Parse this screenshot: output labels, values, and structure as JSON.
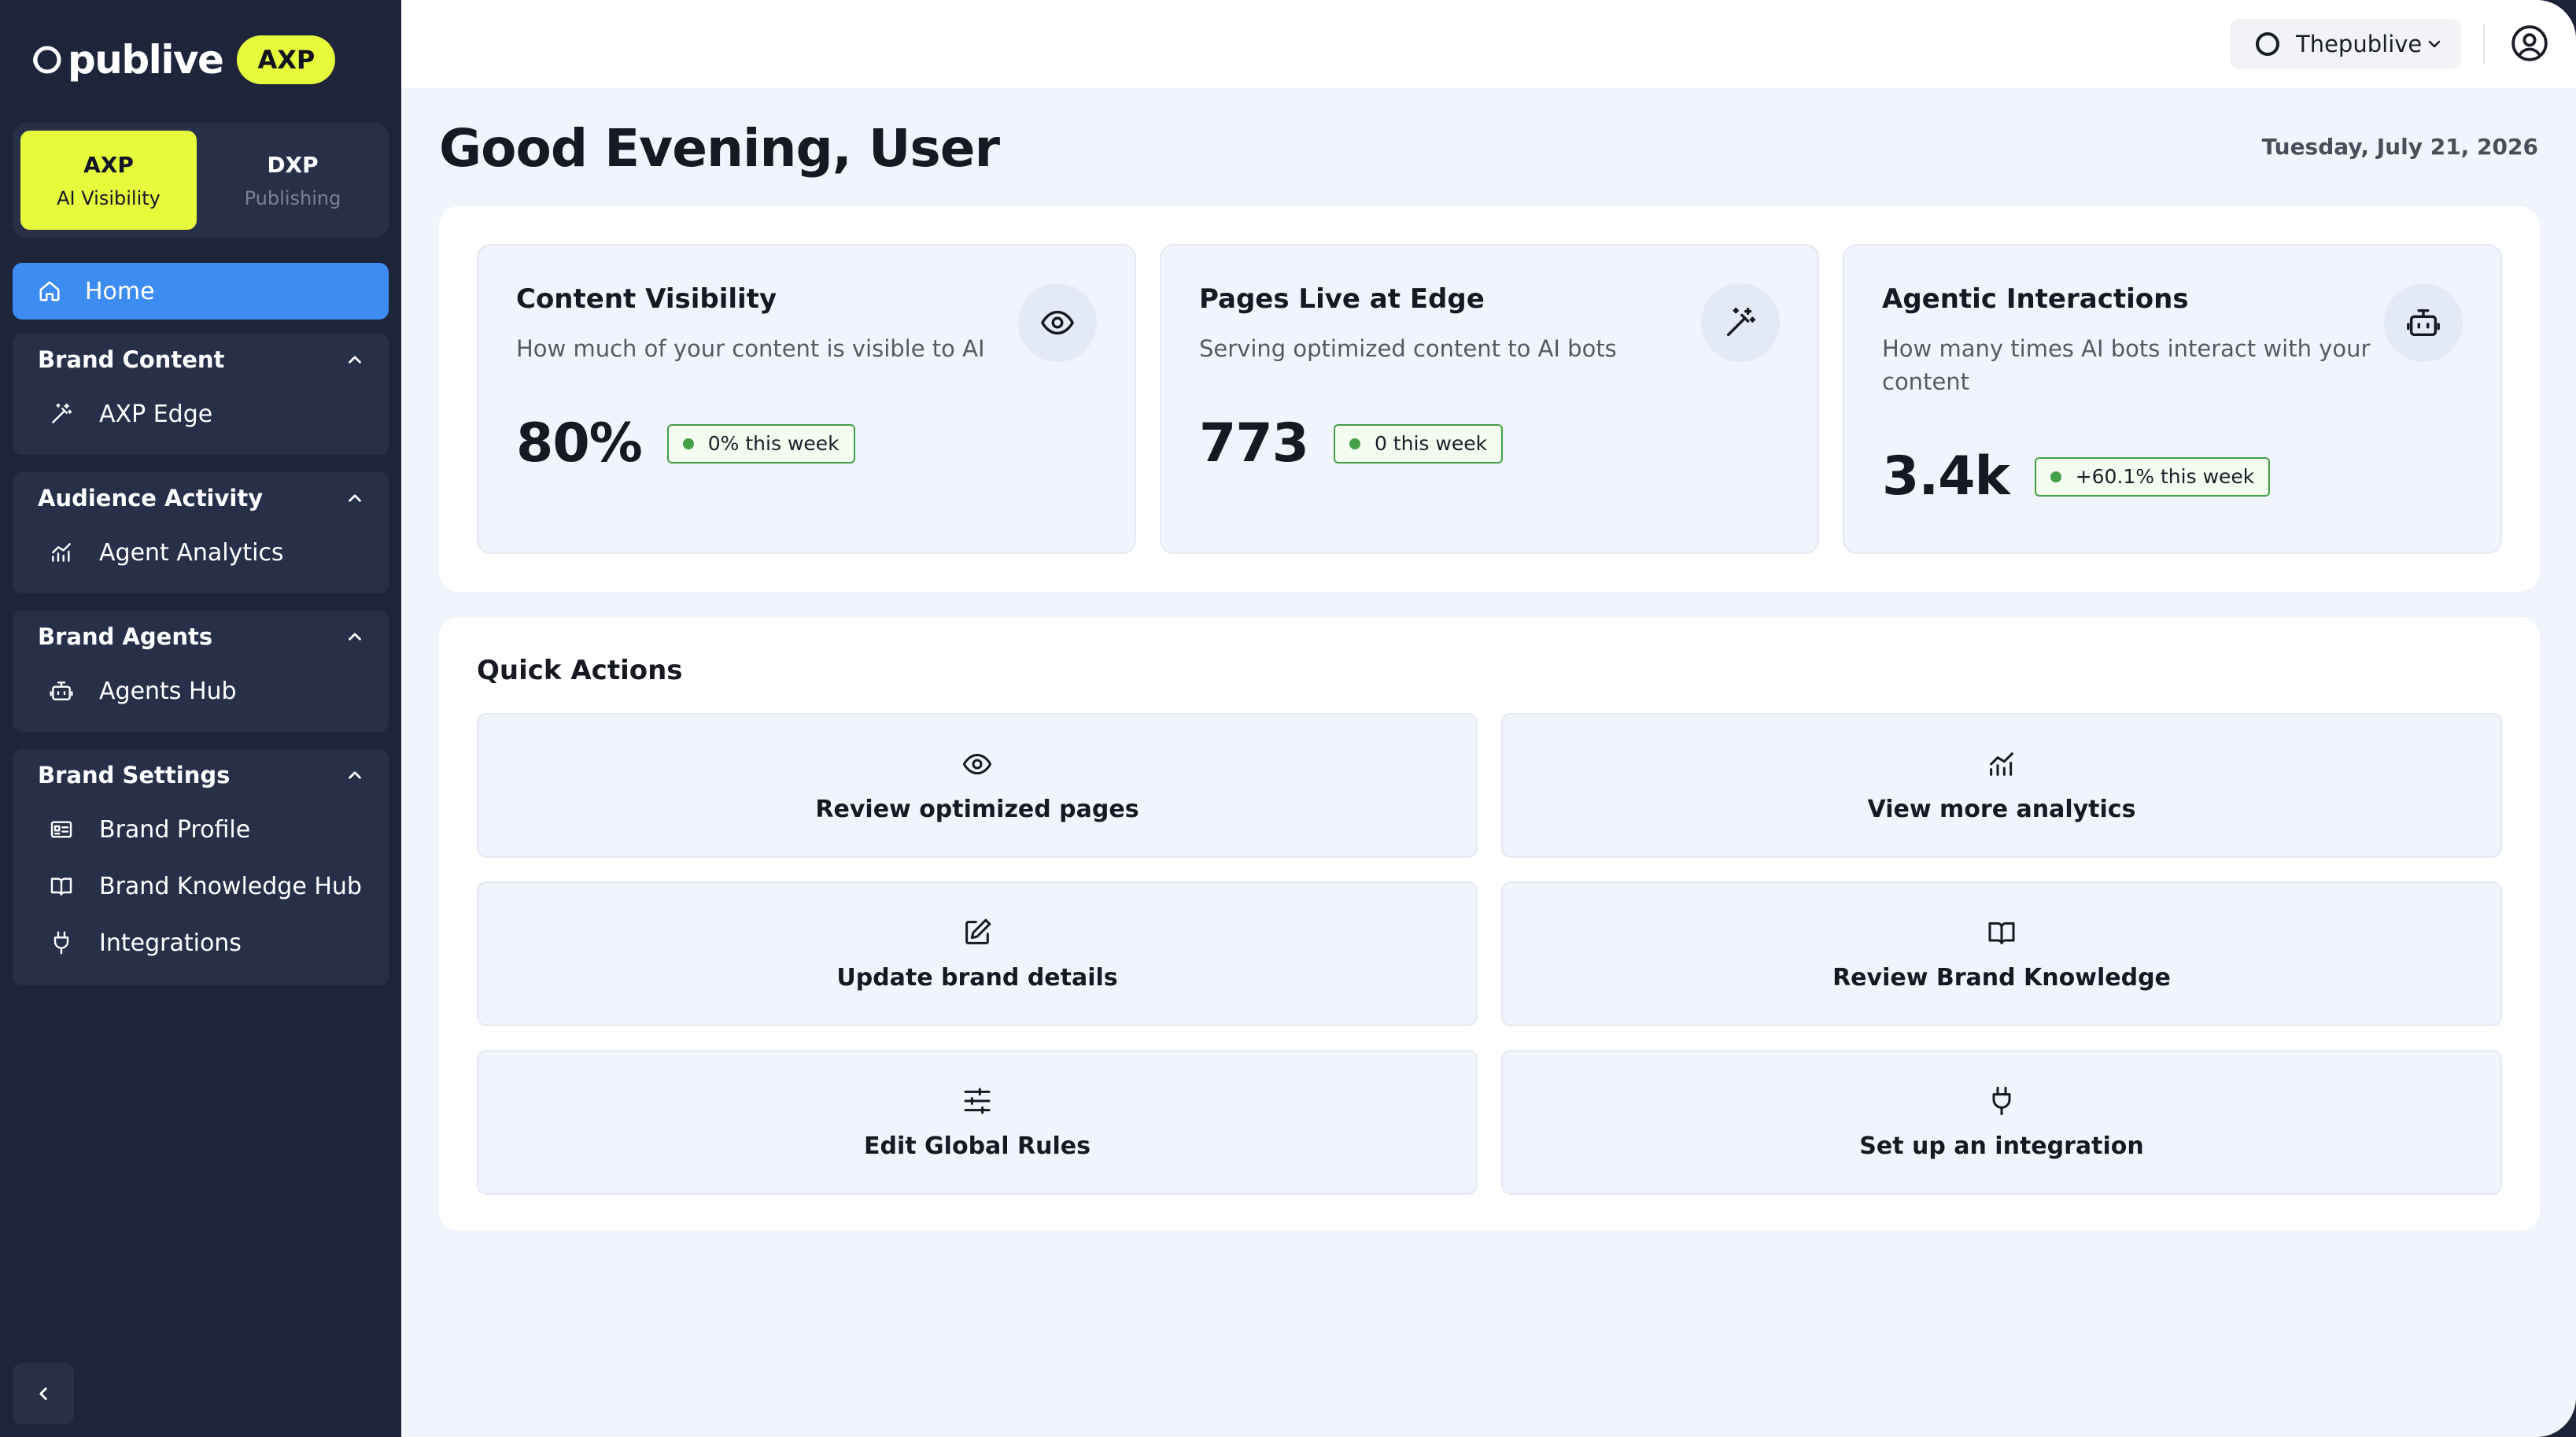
{
  "brand": {
    "name": "publive",
    "badge": "AXP"
  },
  "modes": [
    {
      "title": "AXP",
      "subtitle": "AI Visibility",
      "active": true
    },
    {
      "title": "DXP",
      "subtitle": "Publishing",
      "active": false
    }
  ],
  "nav": {
    "home": "Home",
    "groups": [
      {
        "label": "Brand Content",
        "items": [
          {
            "label": "AXP Edge",
            "icon": "wand-icon"
          }
        ]
      },
      {
        "label": "Audience Activity",
        "items": [
          {
            "label": "Agent Analytics",
            "icon": "analytics-icon"
          }
        ]
      },
      {
        "label": "Brand Agents",
        "items": [
          {
            "label": "Agents Hub",
            "icon": "bot-icon"
          }
        ]
      },
      {
        "label": "Brand Settings",
        "items": [
          {
            "label": "Brand Profile",
            "icon": "id-card-icon"
          },
          {
            "label": "Brand Knowledge Hub",
            "icon": "book-icon"
          },
          {
            "label": "Integrations",
            "icon": "plug-icon"
          }
        ]
      }
    ]
  },
  "header": {
    "workspace": "Thepublive"
  },
  "page": {
    "greeting": "Good Evening, User",
    "date": "Tuesday, July 21, 2026"
  },
  "stats": [
    {
      "title": "Content Visibility",
      "description": "How much of your content is visible to AI",
      "value": "80%",
      "change": "0% this week",
      "icon": "eye-icon"
    },
    {
      "title": "Pages Live at Edge",
      "description": "Serving optimized content to AI bots",
      "value": "773",
      "change": "0 this week",
      "icon": "wand-icon"
    },
    {
      "title": "Agentic Interactions",
      "description": "How many times AI bots interact with your content",
      "value": "3.4k",
      "change": "+60.1% this week",
      "icon": "bot-icon"
    }
  ],
  "quick_actions": {
    "title": "Quick Actions",
    "items": [
      {
        "label": "Review optimized pages",
        "icon": "eye-icon"
      },
      {
        "label": "View more analytics",
        "icon": "analytics-icon"
      },
      {
        "label": "Update brand details",
        "icon": "edit-icon"
      },
      {
        "label": "Review Brand Knowledge",
        "icon": "book-icon"
      },
      {
        "label": "Edit Global Rules",
        "icon": "sliders-icon"
      },
      {
        "label": "Set up an integration",
        "icon": "plug-icon"
      }
    ]
  },
  "colors": {
    "sidebar": "#1e2439",
    "accent": "#e6fb3c",
    "active_nav": "#3d8cf1",
    "positive": "#43a047"
  }
}
